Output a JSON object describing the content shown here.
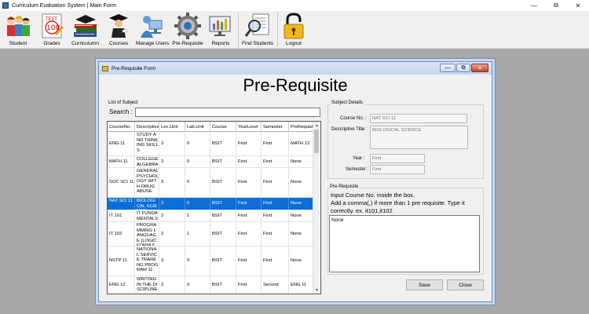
{
  "window": {
    "title": "Curriculum Evaluation System | Main Form",
    "minimize": "—",
    "maximize": "⧉",
    "close": "✕"
  },
  "toolbar": [
    {
      "label": "Student",
      "icon": "student-icon"
    },
    {
      "label": "Grades",
      "icon": "grades-icon"
    },
    {
      "label": "Curriculumn",
      "icon": "books-icon"
    },
    {
      "label": "Courses",
      "icon": "graduate-icon"
    },
    {
      "label": "Manage Users",
      "icon": "users-icon"
    },
    {
      "label": "Pre-Requisite",
      "icon": "gear-icon"
    },
    {
      "label": "Reports",
      "icon": "reports-icon"
    },
    {
      "label": "Find Students",
      "icon": "magnifier-icon"
    },
    {
      "label": "Logout",
      "icon": "lock-icon"
    }
  ],
  "form": {
    "title": "Pre-Requisite Form",
    "heading": "Pre-Requisite",
    "list_label": "List of Subject",
    "search_label": "Search :",
    "search_value": "",
    "details_label": "Subject Details",
    "course_no_label": "Course No. :",
    "course_no_value": "NAT SCI 11",
    "desc_label": "Descriptive Title :",
    "desc_value": "BIOLOGICAL SCIENCE",
    "year_label": "Year :",
    "year_value": "First",
    "semester_label": "Semester :",
    "semester_value": "First",
    "prereq_label": "Pre-Requisite",
    "instruction_1": "Input Course No. inside the box.",
    "instruction_2": "Add a comma(,) if more than  1 pre requisite. Type it",
    "instruction_3": "correctly. ex. it101,it102",
    "prereq_value": "None",
    "save_label": "Save",
    "close_label": "Close"
  },
  "grid": {
    "columns": [
      "CourseNo.",
      "Descriptive",
      "Lec.Unit",
      "Lab.Unit",
      "Course",
      "YearLevel",
      "Semester",
      "PreRequisi"
    ],
    "rows": [
      {
        "cells": [
          "ENG 11",
          "STUDY AND THINKING SKILLS",
          "3",
          "0",
          "BSIT",
          "First",
          "First",
          "MATH 13"
        ]
      },
      {
        "cells": [
          "MATH 11",
          "COLLEGE ALGEBRA",
          "3",
          "0",
          "BSIT",
          "First",
          "First",
          "None"
        ]
      },
      {
        "cells": [
          "SOC SCI 11",
          "GENERAL PSYCHOLOGY WITH DRUG ABUSE",
          "3",
          "0",
          "BSIT",
          "First",
          "First",
          "None"
        ]
      },
      {
        "cells": [
          "NAT SCI 11",
          "BIOLOGICAL SCIENCE",
          "3",
          "0",
          "BSIT",
          "First",
          "First",
          "None"
        ],
        "selected": true
      },
      {
        "cells": [
          "IT 101",
          "IT FUNDAMENTALS",
          "2",
          "1",
          "BSIT",
          "First",
          "First",
          "None"
        ]
      },
      {
        "cells": [
          "IT 102",
          "PROGRAMMING LANGUAGE (LOGIC FORMULATION)",
          "2",
          "1",
          "BSIT",
          "First",
          "First",
          "None"
        ]
      },
      {
        "cells": [
          "NSTP 11",
          "NATIONAL SERVICE TRAINING PROGRAM 11",
          "3",
          "0",
          "BSIT",
          "First",
          "First",
          "None"
        ]
      },
      {
        "cells": [
          "ENG 12",
          "WRITING IN THE DISCIPLINE",
          "3",
          "0",
          "BSIT",
          "First",
          "Second",
          "ENG 11"
        ]
      }
    ]
  }
}
